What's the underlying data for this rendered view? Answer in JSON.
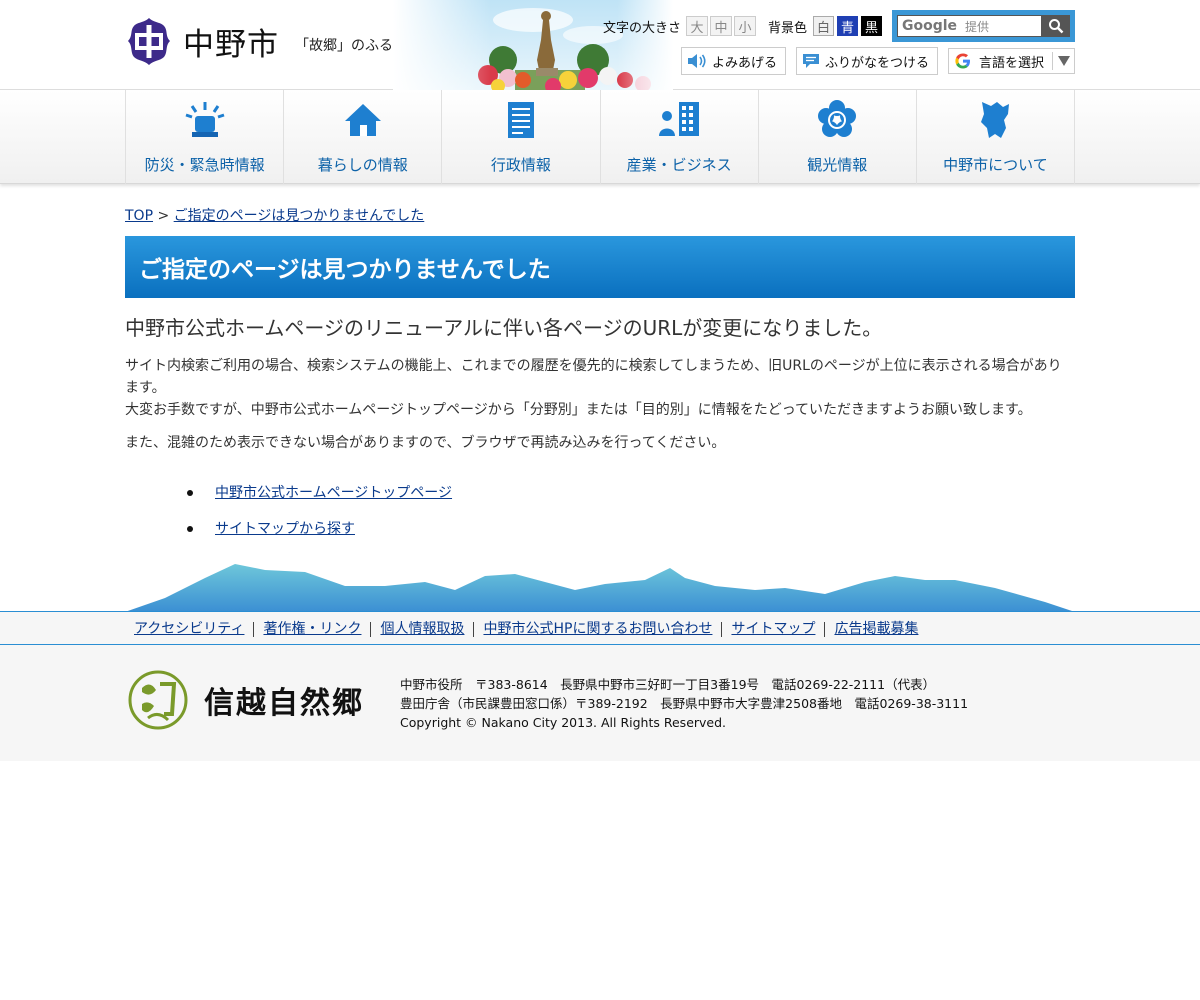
{
  "header": {
    "site_name": "中野市",
    "tagline": "「故郷」のふるさと",
    "font_size": {
      "label": "文字の大きさ",
      "large": "大",
      "medium": "中",
      "small": "小"
    },
    "bg_color": {
      "label": "背景色",
      "white": "白",
      "blue": "青",
      "black": "黒"
    },
    "search": {
      "brand": "Google",
      "placeholder": "提供"
    },
    "read_aloud": "よみあげる",
    "furigana": "ふりがなをつける",
    "language": "言語を選択"
  },
  "nav": [
    {
      "label": "防災・緊急時情報",
      "icon": "siren-icon"
    },
    {
      "label": "暮らしの情報",
      "icon": "house-icon"
    },
    {
      "label": "行政情報",
      "icon": "document-icon"
    },
    {
      "label": "産業・ビジネス",
      "icon": "business-icon"
    },
    {
      "label": "観光情報",
      "icon": "flower-icon"
    },
    {
      "label": "中野市について",
      "icon": "city-map-icon"
    }
  ],
  "breadcrumb": {
    "top": "TOP",
    "sep": ">",
    "current": "ご指定のページは見つかりませんでした"
  },
  "main": {
    "title": "ご指定のページは見つかりませんでした",
    "heading": "中野市公式ホームページのリニューアルに伴い各ページのURLが変更になりました。",
    "para1_line1": "サイト内検索ご利用の場合、検索システムの機能上、これまでの履歴を優先的に検索してしまうため、旧URLのページが上位に表示される場合があります。",
    "para1_line2": "大変お手数ですが、中野市公式ホームページトップページから「分野別」または「目的別」に情報をたどっていただきますようお願い致します。",
    "para2": "また、混雑のため表示できない場合がありますので、ブラウザで再読み込みを行ってください。",
    "links": [
      "中野市公式ホームページトップページ",
      "サイトマップから探す"
    ]
  },
  "footer": {
    "links": [
      "アクセシビリティ",
      "著作権・リンク",
      "個人情報取扱",
      "中野市公式HPに関するお問い合わせ",
      "サイトマップ",
      "広告掲載募集"
    ],
    "logo_text": "信越自然郷",
    "address_line1": "中野市役所　〒383-8614　長野県中野市三好町一丁目3番19号　電話0269-22-2111（代表）",
    "address_line2": "豊田庁舎（市民課豊田窓口係）〒389-2192　長野県中野市大字豊津2508番地　電話0269-38-3111",
    "copyright": "Copyright © Nakano City 2013. All Rights Reserved."
  },
  "colors": {
    "accent_blue": "#0a70bf",
    "nav_text": "#0d62a8",
    "link": "#0a3a8c",
    "logo_purple": "#3d2a8a"
  }
}
